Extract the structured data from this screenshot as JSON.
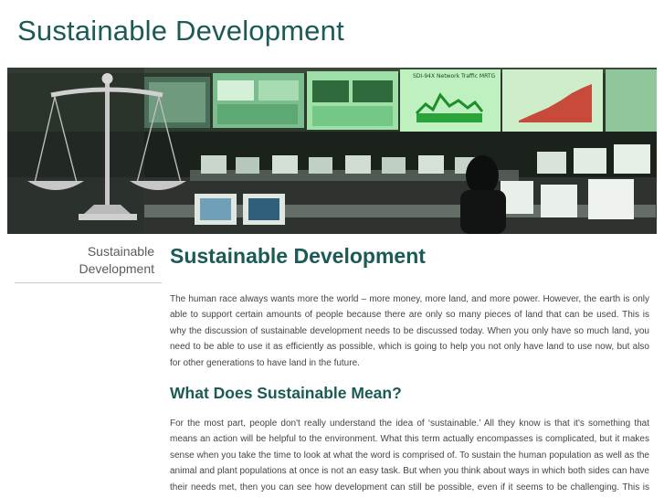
{
  "site": {
    "title": "Sustainable Development"
  },
  "banner": {
    "screen_caption": "SDI-94X Network Traffic MRTG"
  },
  "sidebar": {
    "items": [
      {
        "label": "Sustainable Development"
      }
    ]
  },
  "main": {
    "heading": "Sustainable Development",
    "intro": "The human race always wants more the world – more money, more land, and more power. However, the earth is only able to support certain amounts of people because there are only so many pieces of land that can be used. This is why the discussion of sustainable development needs to be discussed today. When you only have so much land, you need to be able to use it as efficiently as possible, which is going to help you not only have land to use now, but also for other generations to have land in the future.",
    "subheading": "What Does Sustainable Mean?",
    "body": "For the most part, people don't really understand the idea of ‘sustainable.’ All they know is that it's something that means an action will be helpful to the environment. What this term actually encompasses is complicated, but it makes sense when you take the time to look at what the word is comprised of. To sustain the human population as well as the animal and plant populations at once is not an easy task. But when you think about ways in which both sides can have their needs met, then you can see how development can still be possible, even if it seems to be challenging. This is simply a system of looking for ways to make sure that we're not ruining the land or the ecosystems in the"
  }
}
